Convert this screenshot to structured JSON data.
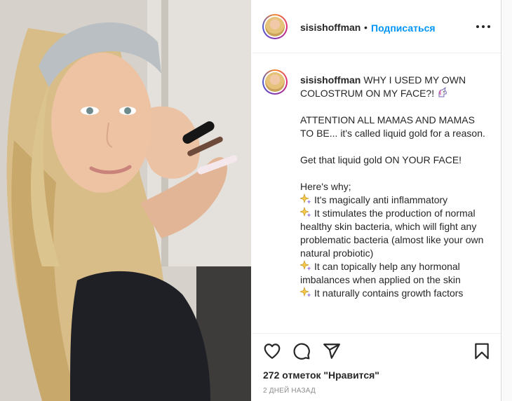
{
  "post": {
    "photo_alt": "photo",
    "author": "sisishoffman",
    "follow_label": "Подписаться",
    "separator": "•",
    "caption": {
      "author": "sisishoffman",
      "intro": "WHY I USED MY OWN COLOSTRUM ON MY FACE?!",
      "para1": "ATTENTION ALL MAMAS AND MAMAS TO BE... it's called liquid gold for a reason.",
      "para2": "Get that liquid gold ON YOUR FACE!",
      "heres_why": "Here's why;",
      "point1": "It's magically anti inflammatory",
      "point2": "It stimulates the production of normal healthy skin bacteria, which will fight any problematic bacteria (almost like your own natural probiotic)",
      "point3": "It can topically help any hormonal imbalances when applied on the skin",
      "point4": "It naturally contains growth factors"
    },
    "likes_text": "272 отметок \"Нравится\"",
    "date_text": "2 ДНЕЙ НАЗАД"
  },
  "colors": {
    "link_blue": "#0095f6",
    "text": "#262626",
    "muted": "#8e8e8e"
  },
  "icons": {
    "like": "heart-icon",
    "comment": "comment-icon",
    "share": "paper-plane-icon",
    "save": "bookmark-icon",
    "more": "more-options-icon",
    "bullet": "sparkles-icon",
    "unicorn": "unicorn-icon"
  }
}
